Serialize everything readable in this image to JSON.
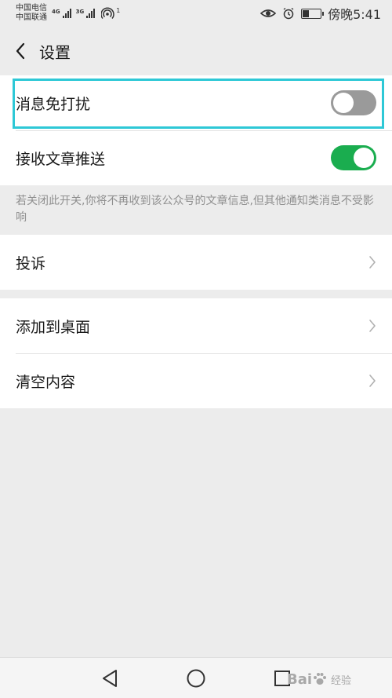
{
  "status_bar": {
    "carrier_1": "中国电信",
    "carrier_2": "中国联通",
    "net_1": "4G",
    "net_2": "3G",
    "hotspot_count": "1",
    "time": "傍晚5:41",
    "battery_level": 0.35,
    "icons": [
      "eye-icon",
      "alarm-icon",
      "battery-icon",
      "signal-icon",
      "hotspot-icon"
    ]
  },
  "header": {
    "title": "设置",
    "back_icon": "chevron-left-icon"
  },
  "settings": {
    "dnd_label": "消息免打扰",
    "dnd_enabled": false,
    "push_label": "接收文章推送",
    "push_enabled": true,
    "note": "若关闭此开关,你将不再收到该公众号的文章信息,但其他通知类消息不受影响",
    "complain_label": "投诉",
    "add_desktop_label": "添加到桌面",
    "clear_label": "清空内容"
  },
  "colors": {
    "toggle_on": "#1aad4f",
    "toggle_off": "#9a9a9a",
    "highlight": "#2ec8d6",
    "background": "#ececec"
  },
  "nav_bar": {
    "icons": [
      "back-triangle-icon",
      "home-circle-icon",
      "recents-square-icon"
    ]
  },
  "watermark": {
    "text": "Bai",
    "sub": "经验"
  }
}
